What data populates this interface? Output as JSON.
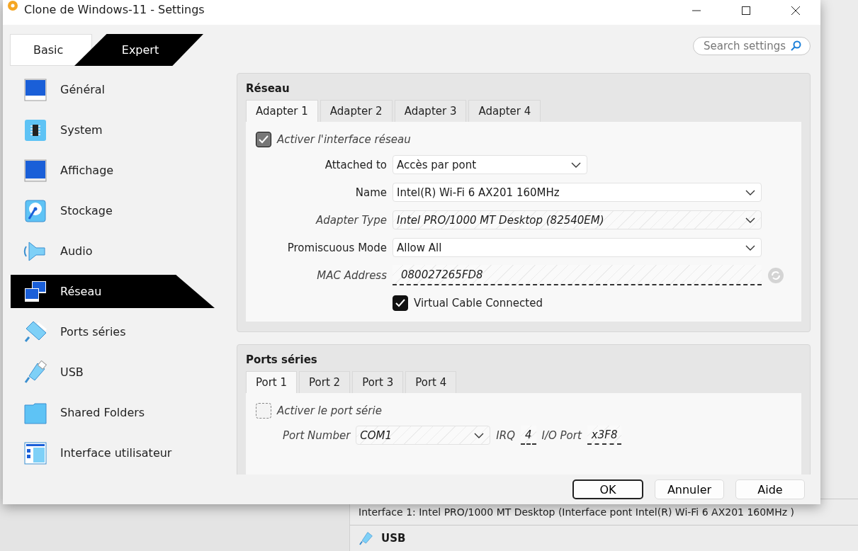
{
  "window": {
    "title": "Clone de Windows-11 - Settings"
  },
  "mode_tabs": [
    {
      "label": "Basic",
      "selected": false
    },
    {
      "label": "Expert",
      "selected": true
    }
  ],
  "search": {
    "placeholder": "Search settings"
  },
  "sidebar": {
    "items": [
      {
        "label": "Général",
        "kind": "general",
        "selected": false
      },
      {
        "label": "System",
        "kind": "system",
        "selected": false
      },
      {
        "label": "Affichage",
        "kind": "display",
        "selected": false
      },
      {
        "label": "Stockage",
        "kind": "storage",
        "selected": false
      },
      {
        "label": "Audio",
        "kind": "audio",
        "selected": false
      },
      {
        "label": "Réseau",
        "kind": "network",
        "selected": true
      },
      {
        "label": "Ports séries",
        "kind": "serial",
        "selected": false
      },
      {
        "label": "USB",
        "kind": "usb",
        "selected": false
      },
      {
        "label": "Shared Folders",
        "kind": "folder",
        "selected": false
      },
      {
        "label": "Interface utilisateur",
        "kind": "ui",
        "selected": false
      }
    ]
  },
  "network": {
    "title": "Réseau",
    "tabs": [
      {
        "label": "Adapter 1",
        "selected": true
      },
      {
        "label": "Adapter 2",
        "selected": false
      },
      {
        "label": "Adapter 3",
        "selected": false
      },
      {
        "label": "Adapter 4",
        "selected": false
      }
    ],
    "enable": {
      "label": "Activer l'interface réseau",
      "checked": true,
      "disabled": true
    },
    "fields": [
      {
        "kind": "short_select",
        "label": "Attached to",
        "value": "Accès par pont",
        "disabled": false
      },
      {
        "kind": "select",
        "label": "Name",
        "value": "Intel(R) Wi-Fi 6 AX201 160MHz",
        "disabled": false
      },
      {
        "kind": "select",
        "label": "Adapter Type",
        "value": "Intel PRO/1000 MT Desktop (82540EM)",
        "disabled": true
      },
      {
        "kind": "select",
        "label": "Promiscuous Mode",
        "value": "Allow All",
        "disabled": false
      },
      {
        "kind": "text",
        "label": "MAC Address",
        "value": "080027265FD8",
        "disabled": true
      },
      {
        "kind": "checkbox",
        "label": "Virtual Cable Connected",
        "checked": true,
        "disabled": false
      }
    ]
  },
  "serial": {
    "title": "Ports séries",
    "tabs": [
      {
        "label": "Port 1",
        "selected": true
      },
      {
        "label": "Port 2",
        "selected": false
      },
      {
        "label": "Port 3",
        "selected": false
      },
      {
        "label": "Port 4",
        "selected": false
      }
    ],
    "enable": {
      "label": "Activer le port série",
      "checked": false,
      "disabled": true
    },
    "port_number": {
      "label": "Port Number",
      "value": "COM1"
    },
    "irq": {
      "label": "IRQ",
      "value": "4"
    },
    "io_port": {
      "label": "I/O Port",
      "value": "x3F8"
    }
  },
  "buttons": [
    {
      "label": "OK",
      "default": true
    },
    {
      "label": "Annuler",
      "default": false
    },
    {
      "label": "Aide",
      "default": false
    }
  ],
  "background": {
    "details_row": "Interface 1:   Intel PRO/1000 MT Desktop (Interface pont Intel(R) Wi-Fi 6 AX201 160MHz )",
    "usb_header": "USB"
  }
}
